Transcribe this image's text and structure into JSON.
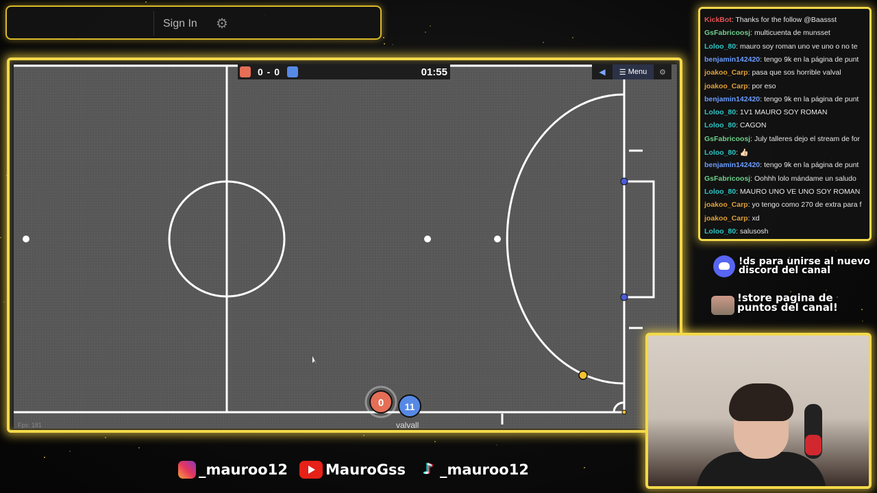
{
  "topbar": {
    "signin_label": "Sign In",
    "settings_icon": "gear-icon"
  },
  "game": {
    "score_red": 0,
    "score_blue": 0,
    "score_text": "0 - 0",
    "timer": "01:55",
    "menu_label": "Menu",
    "sound_icon": "speaker-icon",
    "settings_icon": "gear-icon",
    "fps_text": "Fps: 181",
    "player_name": "valvall",
    "red_player_number": "0",
    "blue_player_number": "11",
    "colors": {
      "red": "#e56e56",
      "blue": "#5689e5",
      "ball": "#f2c12e",
      "field": "#575757"
    }
  },
  "chat": {
    "messages": [
      {
        "user": "KickBot",
        "text": "Thanks for the follow @Baassst",
        "color": "#e55454"
      },
      {
        "user": "GsFabricoosj",
        "text": "multicuenta de munsset",
        "color": "#6fd08c"
      },
      {
        "user": "Loloo_80",
        "text": "mauro soy roman uno ve uno o no te",
        "color": "#2ec4c4"
      },
      {
        "user": "benjamin142420",
        "text": "tengo 9k en la página de punt",
        "color": "#6a9cff"
      },
      {
        "user": "joakoo_Carp",
        "text": "pasa que sos horrible valval",
        "color": "#e0a03a"
      },
      {
        "user": "joakoo_Carp",
        "text": "por eso",
        "color": "#e0a03a"
      },
      {
        "user": "benjamin142420",
        "text": "tengo 9k en la página de punt",
        "color": "#6a9cff"
      },
      {
        "user": "Loloo_80",
        "text": "1V1 MAURO SOY ROMAN",
        "color": "#2ec4c4"
      },
      {
        "user": "Loloo_80",
        "text": "CAGON",
        "color": "#2ec4c4"
      },
      {
        "user": "GsFabricoosj",
        "text": "July talleres dejo el stream de for",
        "color": "#6fd08c"
      },
      {
        "user": "Loloo_80",
        "text": "👍🏻",
        "color": "#2ec4c4"
      },
      {
        "user": "benjamin142420",
        "text": "tengo 9k en la página de punt",
        "color": "#6a9cff"
      },
      {
        "user": "GsFabricoosj",
        "text": "Oohhh lolo mándame un saludo",
        "color": "#6fd08c"
      },
      {
        "user": "Loloo_80",
        "text": "MAURO UNO VE UNO SOY ROMAN",
        "color": "#2ec4c4"
      },
      {
        "user": "joakoo_Carp",
        "text": "yo tengo como 270 de extra para f",
        "color": "#e0a03a"
      },
      {
        "user": "joakoo_Carp",
        "text": "xd",
        "color": "#e0a03a"
      },
      {
        "user": "Loloo_80",
        "text": "salusosh",
        "color": "#2ec4c4"
      }
    ]
  },
  "promos": {
    "discord_line1": "!ds para unirse al nuevo",
    "discord_line2": "discord del canal",
    "store_line1": "!store pagina de",
    "store_line2": "puntos del canal!"
  },
  "social": {
    "instagram": "_mauroo12",
    "youtube": "MauroGss",
    "tiktok": "_mauroo12"
  }
}
